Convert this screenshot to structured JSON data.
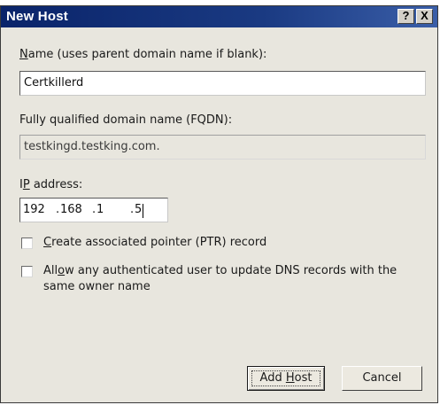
{
  "window": {
    "title": "New Host",
    "help_glyph": "?",
    "close_glyph": "X"
  },
  "name_field": {
    "label_prefix": "N",
    "label_rest": "ame (uses parent domain name if blank):",
    "value": "Certkillerd"
  },
  "fqdn_field": {
    "label": "Fully qualified domain name (FQDN):",
    "value": "testkingd.testking.com."
  },
  "ip_field": {
    "label_prefix": "I",
    "label_mid": "P",
    "label_rest": " address:",
    "octets": [
      "192",
      "168",
      "1",
      "5"
    ],
    "dot": "."
  },
  "ptr_checkbox": {
    "label_prefix": "C",
    "label_rest": "reate associated pointer (PTR) record",
    "checked": false
  },
  "auth_checkbox": {
    "label_line1_pre": "All",
    "label_line1_u": "o",
    "label_line1_rest": "w any authenticated user to update DNS records with the",
    "label_line2": "same owner name",
    "checked": false
  },
  "buttons": {
    "add_host_pre": "Add ",
    "add_host_u": "H",
    "add_host_rest": "ost",
    "cancel": "Cancel"
  }
}
